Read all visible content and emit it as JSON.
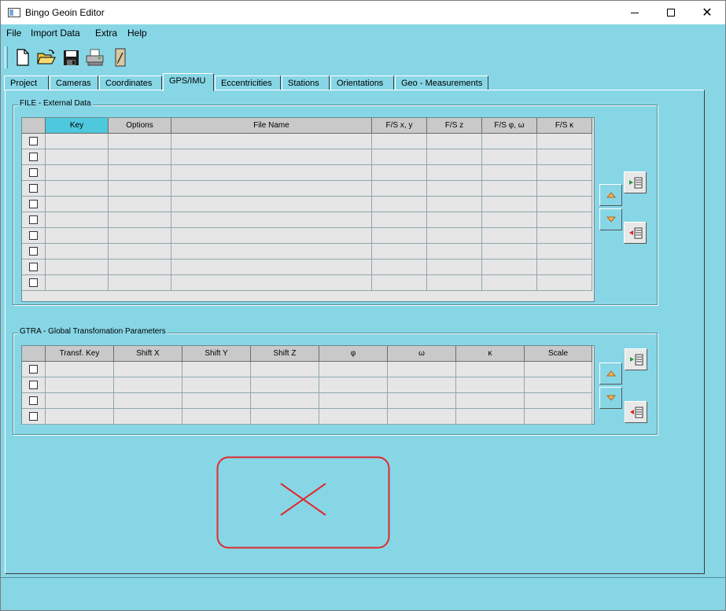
{
  "window": {
    "title": "Bingo Geoin Editor"
  },
  "menu": {
    "items": [
      "File",
      "Import Data",
      "Extra",
      "Help"
    ]
  },
  "toolbar": {
    "buttons": [
      "new-file-icon",
      "open-folder-icon",
      "save-disk-icon",
      "print-icon",
      "edit-note-icon"
    ]
  },
  "tabs": [
    {
      "label": "Project",
      "active": false
    },
    {
      "label": "Cameras",
      "active": false
    },
    {
      "label": "Coordinates",
      "active": false
    },
    {
      "label": "GPS/IMU",
      "active": true
    },
    {
      "label": "Eccentricities",
      "active": false
    },
    {
      "label": "Stations",
      "active": false
    },
    {
      "label": "Orientations",
      "active": false
    },
    {
      "label": "Geo - Measurements",
      "active": false
    }
  ],
  "file_group": {
    "title": "FILE - External Data",
    "columns": [
      "Key",
      "Options",
      "File Name",
      "F/S x, y",
      "F/S z",
      "F/S φ, ω",
      "F/S  κ"
    ],
    "row_count": 10
  },
  "gtra_group": {
    "title": "GTRA - Global Transfomation Parameters",
    "columns": [
      "Transf. Key",
      "Shift X",
      "Shift Y",
      "Shift Z",
      "φ",
      "ω",
      "κ",
      "Scale"
    ],
    "row_count": 4
  },
  "colors": {
    "background": "#87d6e6",
    "key_header": "#4ec8dc",
    "delete_border": "#e0282c"
  },
  "side_buttons": [
    "add-row-icon",
    "move-up-icon",
    "move-down-icon",
    "remove-row-icon"
  ],
  "delete_area": {
    "icon": "red-x-icon"
  }
}
